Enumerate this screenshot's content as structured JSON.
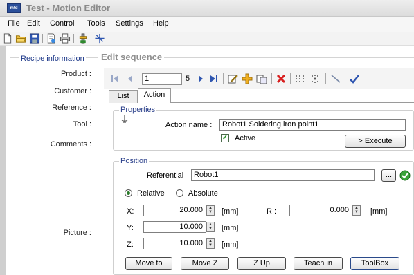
{
  "window": {
    "title": "Test - Motion Editor",
    "app_icon_text": "mtd"
  },
  "menu": [
    "File",
    "Edit",
    "Control",
    "Tools",
    "Settings",
    "Help"
  ],
  "recipe": {
    "legend": "Recipe information",
    "labels": {
      "product": "Product :",
      "customer": "Customer :",
      "reference": "Reference :",
      "tool": "Tool :",
      "comments": "Comments :",
      "picture": "Picture :"
    }
  },
  "edit": {
    "legend": "Edit sequence",
    "nav": {
      "current": "1",
      "total": "5"
    },
    "tabs": [
      "List",
      "Action"
    ],
    "active_tab": "Action"
  },
  "properties": {
    "legend": "Properties",
    "action_name_label": "Action name :",
    "action_name_value": "Robot1 Soldering iron point1",
    "active_label": "Active",
    "active_checked": true,
    "execute_label": "> Execute"
  },
  "position": {
    "legend": "Position",
    "referential_label": "Referential",
    "referential_value": "Robot1",
    "browse_label": "...",
    "mode_options": [
      "Relative",
      "Absolute"
    ],
    "mode_selected": "Relative",
    "x_label": "X:",
    "x_value": "20.000",
    "y_label": "Y:",
    "y_value": "10.000",
    "z_label": "Z:",
    "z_value": "10.000",
    "r_label": "R :",
    "r_value": "0.000",
    "unit": "[mm]",
    "buttons": [
      "Move to",
      "Move Z",
      "Z Up",
      "Teach in",
      "ToolBox"
    ]
  },
  "colors": {
    "accent_blue": "#2a3f8a",
    "status_green": "#3aa23a"
  }
}
